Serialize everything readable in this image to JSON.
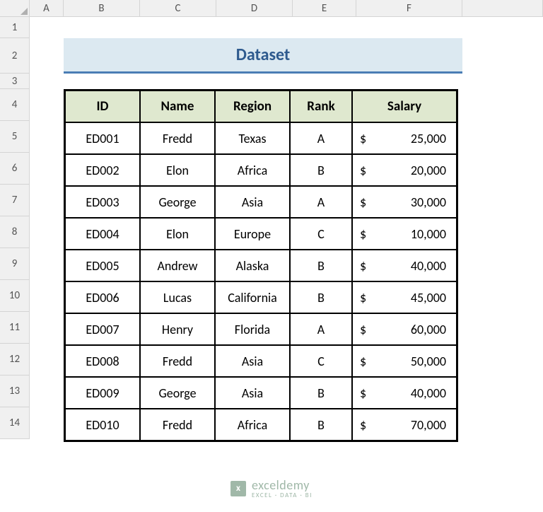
{
  "columns": [
    "A",
    "B",
    "C",
    "D",
    "E",
    "F"
  ],
  "rows": [
    "1",
    "2",
    "3",
    "4",
    "5",
    "6",
    "7",
    "8",
    "9",
    "10",
    "11",
    "12",
    "13",
    "14"
  ],
  "title": "Dataset",
  "headers": {
    "id": "ID",
    "name": "Name",
    "region": "Region",
    "rank": "Rank",
    "salary": "Salary"
  },
  "currency": "$",
  "data": [
    {
      "id": "ED001",
      "name": "Fredd",
      "region": "Texas",
      "rank": "A",
      "salary": "25,000"
    },
    {
      "id": "ED002",
      "name": "Elon",
      "region": "Africa",
      "rank": "B",
      "salary": "20,000"
    },
    {
      "id": "ED003",
      "name": "George",
      "region": "Asia",
      "rank": "A",
      "salary": "30,000"
    },
    {
      "id": "ED004",
      "name": "Elon",
      "region": "Europe",
      "rank": "C",
      "salary": "10,000"
    },
    {
      "id": "ED005",
      "name": "Andrew",
      "region": "Alaska",
      "rank": "B",
      "salary": "40,000"
    },
    {
      "id": "ED006",
      "name": "Lucas",
      "region": "California",
      "rank": "B",
      "salary": "45,000"
    },
    {
      "id": "ED007",
      "name": "Henry",
      "region": "Florida",
      "rank": "A",
      "salary": "60,000"
    },
    {
      "id": "ED008",
      "name": "Fredd",
      "region": "Asia",
      "rank": "C",
      "salary": "50,000"
    },
    {
      "id": "ED009",
      "name": "George",
      "region": "Asia",
      "rank": "B",
      "salary": "40,000"
    },
    {
      "id": "ED010",
      "name": "Fredd",
      "region": "Africa",
      "rank": "B",
      "salary": "70,000"
    }
  ],
  "watermark": {
    "main": "exceldemy",
    "sub": "EXCEL · DATA · BI"
  }
}
